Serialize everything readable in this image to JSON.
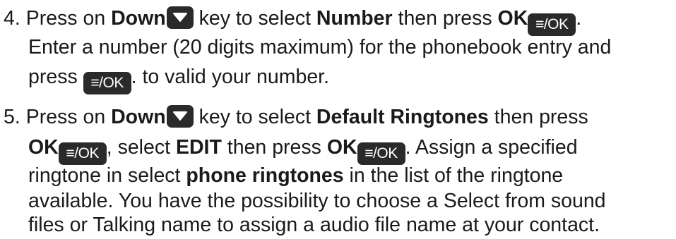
{
  "step4": {
    "number": "4.",
    "line1_a": "Press on ",
    "line1_b": "Down",
    "line1_c": " key to select ",
    "line1_d": "Number",
    "line1_e": " then press ",
    "line1_f": "OK",
    "line1_g": ".",
    "line2": "Enter a number (20 digits maximum) for the phonebook entry and",
    "line3_a": "press ",
    "line3_b": ". to valid your number."
  },
  "step5": {
    "number": "5.",
    "line1_a": "Press on ",
    "line1_b": "Down",
    "line1_c": " key to select ",
    "line1_d": "Default Ringtones",
    "line1_e": " then press",
    "line2_a": "OK",
    "line2_b": ", select ",
    "line2_c": "EDIT",
    "line2_d": " then press ",
    "line2_e": "OK",
    "line2_f": ". Assign a specified",
    "line3_a": "ringtone in select ",
    "line3_b": "phone ringtones",
    "line3_c": " in the list of the ringtone",
    "line4": "available. You have the possibility to choose a Select from sound",
    "line5": "files or Talking name to assign a audio file name at your contact."
  },
  "keys": {
    "ok_label": "≡/OK",
    "down_icon": "down-arrow-key-icon",
    "ok_icon": "menu-ok-key-icon"
  }
}
